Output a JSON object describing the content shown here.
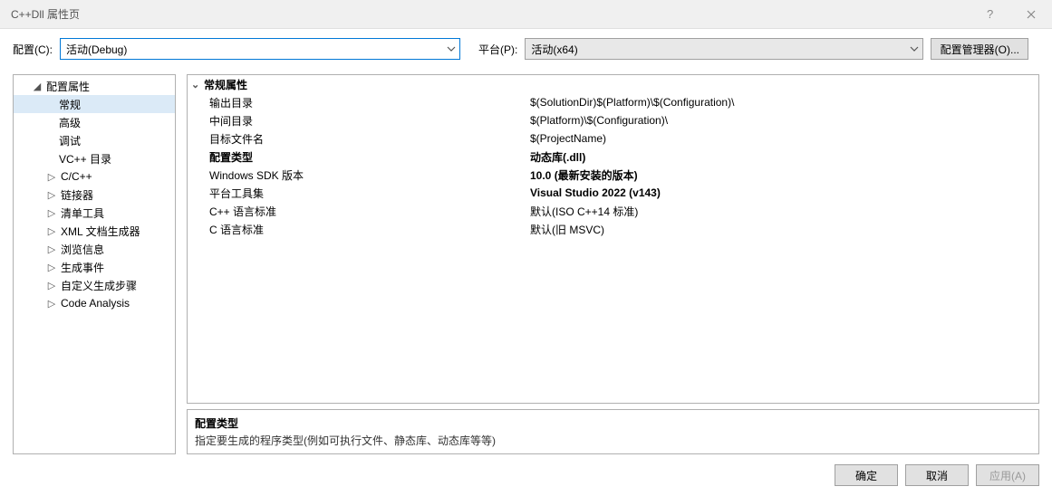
{
  "window": {
    "title": "C++Dll 属性页",
    "help_icon": "help-icon",
    "close_icon": "close-icon"
  },
  "configRow": {
    "config_label": "配置(C):",
    "config_value": "活动(Debug)",
    "platform_label": "平台(P):",
    "platform_value": "活动(x64)",
    "manager_label": "配置管理器(O)..."
  },
  "sidebar": {
    "root": {
      "label": "配置属性",
      "expanded": true
    },
    "items": [
      {
        "label": "常规",
        "selected": true
      },
      {
        "label": "高级"
      },
      {
        "label": "调试"
      },
      {
        "label": "VC++ 目录"
      },
      {
        "label": "C/C++",
        "expandable": true
      },
      {
        "label": "链接器",
        "expandable": true
      },
      {
        "label": "清单工具",
        "expandable": true
      },
      {
        "label": "XML 文档生成器",
        "expandable": true
      },
      {
        "label": "浏览信息",
        "expandable": true
      },
      {
        "label": "生成事件",
        "expandable": true
      },
      {
        "label": "自定义生成步骤",
        "expandable": true
      },
      {
        "label": "Code Analysis",
        "expandable": true
      }
    ]
  },
  "propertyGrid": {
    "section": "常规属性",
    "rows": [
      {
        "label": "输出目录",
        "value": "$(SolutionDir)$(Platform)\\$(Configuration)\\"
      },
      {
        "label": "中间目录",
        "value": "$(Platform)\\$(Configuration)\\"
      },
      {
        "label": "目标文件名",
        "value": "$(ProjectName)"
      },
      {
        "label": "配置类型",
        "value": "动态库(.dll)",
        "bold": true,
        "selected": true
      },
      {
        "label": "Windows SDK 版本",
        "value": "10.0 (最新安装的版本)",
        "bold": true
      },
      {
        "label": "平台工具集",
        "value": "Visual Studio 2022 (v143)",
        "bold": true
      },
      {
        "label": "C++ 语言标准",
        "value": "默认(ISO C++14 标准)"
      },
      {
        "label": "C 语言标准",
        "value": "默认(旧 MSVC)"
      }
    ]
  },
  "description": {
    "title": "配置类型",
    "text": "指定要生成的程序类型(例如可执行文件、静态库、动态库等等)"
  },
  "footer": {
    "ok": "确定",
    "cancel": "取消",
    "apply": "应用(A)"
  }
}
